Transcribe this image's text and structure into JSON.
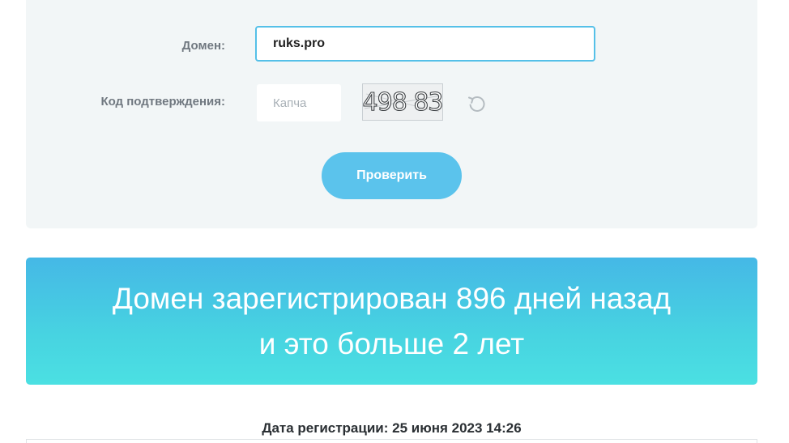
{
  "form": {
    "domain_label": "Домен:",
    "domain_value": "ruks.pro",
    "captcha_label": "Код подтверждения:",
    "captcha_placeholder": "Капча",
    "captcha_image_text": "498 83",
    "refresh_icon": "refresh-icon",
    "submit_label": "Проверить"
  },
  "result": {
    "line1": "Домен зарегистрирован 896 дней назад",
    "line2": "и это больше 2 лет"
  },
  "details": {
    "registration_date": "Дата регистрации: 25 июня 2023 14:26"
  },
  "colors": {
    "accent": "#5bc3ec",
    "banner_top": "#45b8e6",
    "banner_bottom": "#4be0e2",
    "panel_bg": "#f2f6f7"
  }
}
